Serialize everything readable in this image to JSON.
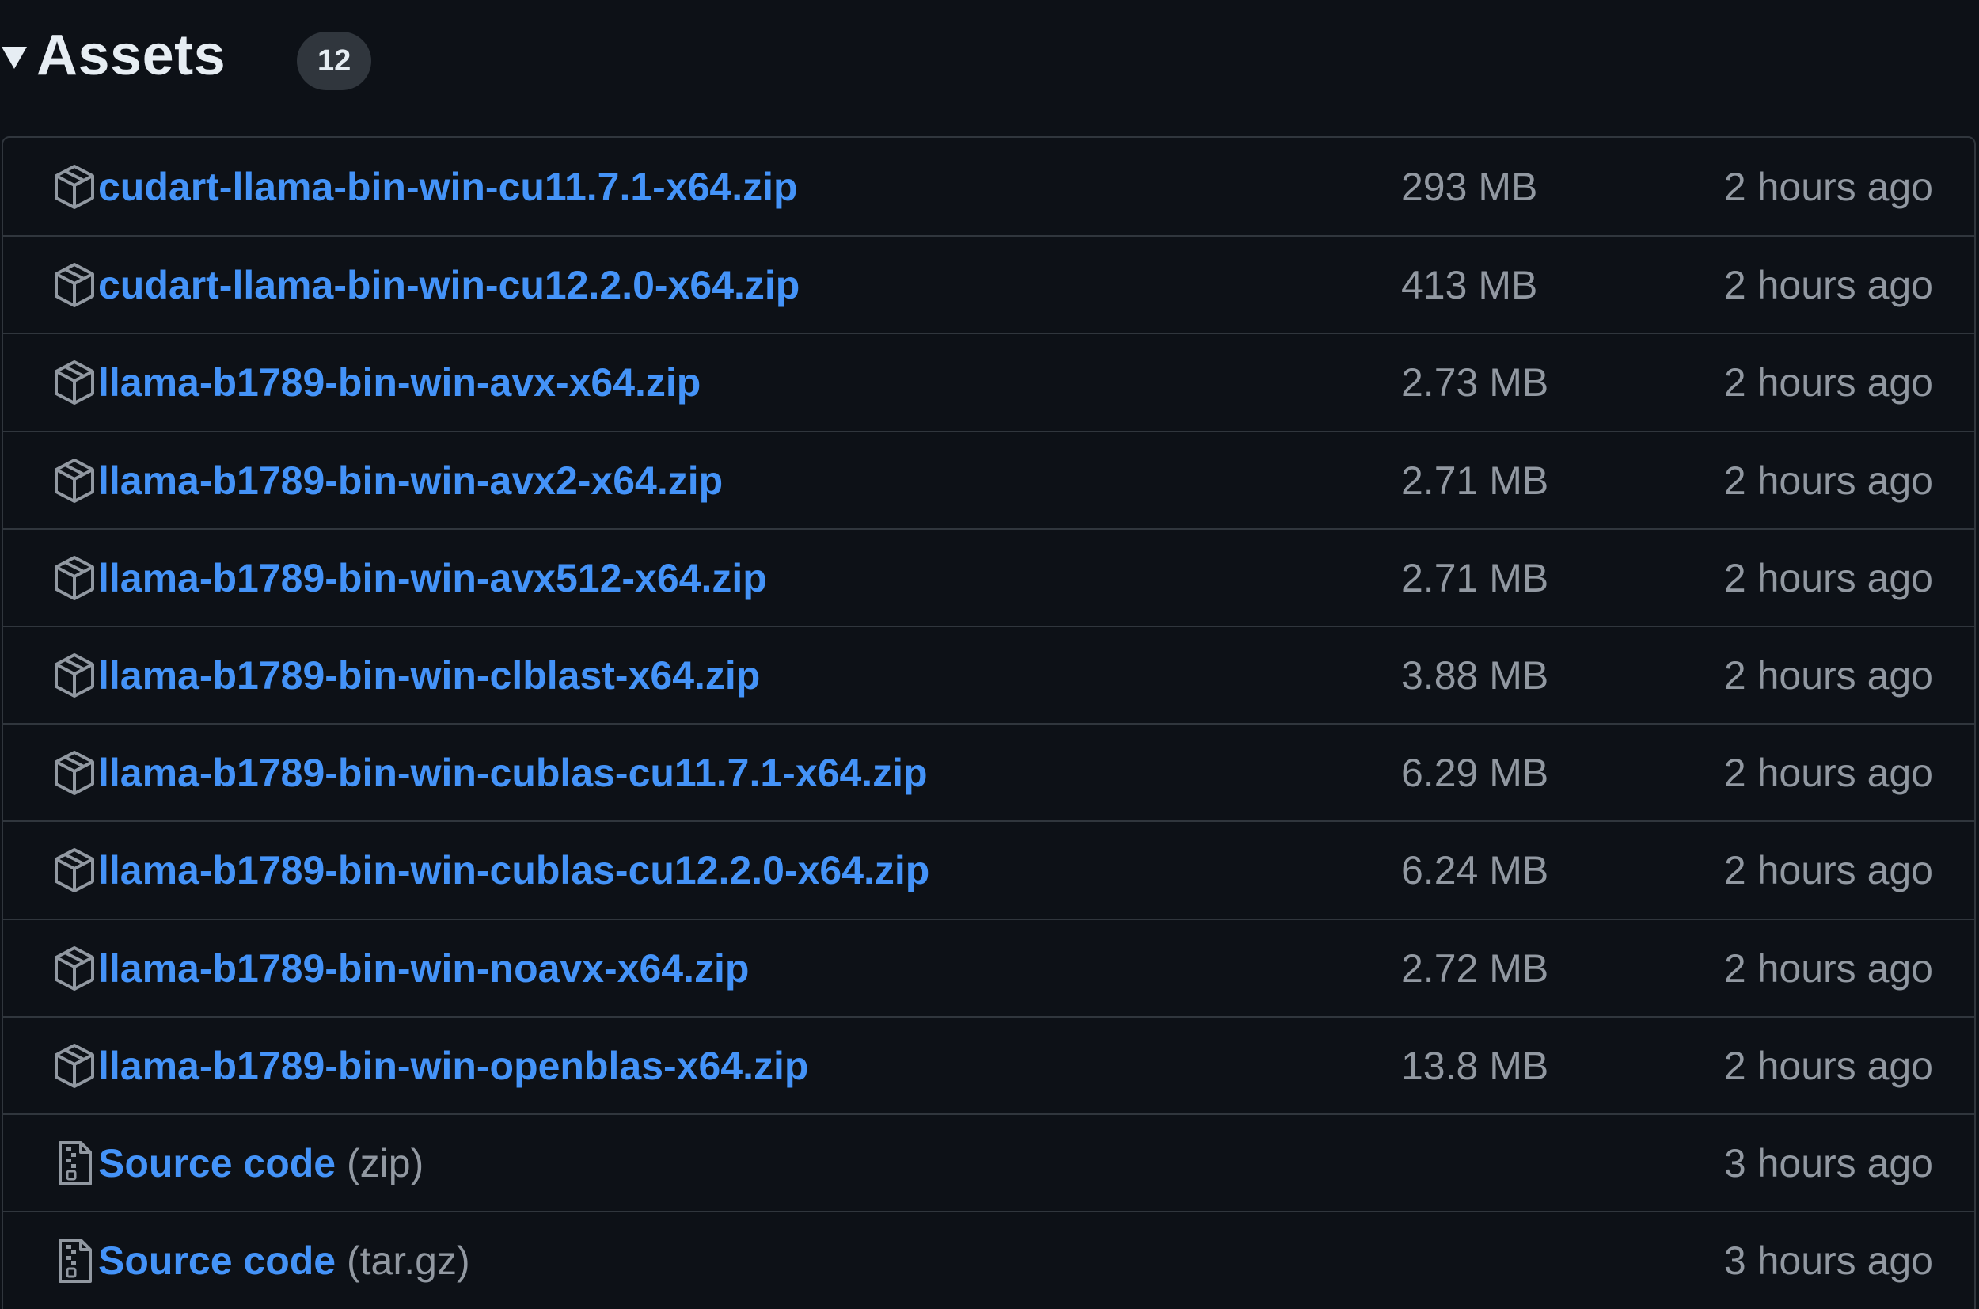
{
  "header": {
    "title": "Assets",
    "count": "12"
  },
  "assets": [
    {
      "name": "cudart-llama-bin-win-cu11.7.1-x64.zip",
      "size": "293 MB",
      "time": "2 hours ago",
      "icon": "package-icon"
    },
    {
      "name": "cudart-llama-bin-win-cu12.2.0-x64.zip",
      "size": "413 MB",
      "time": "2 hours ago",
      "icon": "package-icon"
    },
    {
      "name": "llama-b1789-bin-win-avx-x64.zip",
      "size": "2.73 MB",
      "time": "2 hours ago",
      "icon": "package-icon"
    },
    {
      "name": "llama-b1789-bin-win-avx2-x64.zip",
      "size": "2.71 MB",
      "time": "2 hours ago",
      "icon": "package-icon"
    },
    {
      "name": "llama-b1789-bin-win-avx512-x64.zip",
      "size": "2.71 MB",
      "time": "2 hours ago",
      "icon": "package-icon"
    },
    {
      "name": "llama-b1789-bin-win-clblast-x64.zip",
      "size": "3.88 MB",
      "time": "2 hours ago",
      "icon": "package-icon"
    },
    {
      "name": "llama-b1789-bin-win-cublas-cu11.7.1-x64.zip",
      "size": "6.29 MB",
      "time": "2 hours ago",
      "icon": "package-icon"
    },
    {
      "name": "llama-b1789-bin-win-cublas-cu12.2.0-x64.zip",
      "size": "6.24 MB",
      "time": "2 hours ago",
      "icon": "package-icon"
    },
    {
      "name": "llama-b1789-bin-win-noavx-x64.zip",
      "size": "2.72 MB",
      "time": "2 hours ago",
      "icon": "package-icon"
    },
    {
      "name": "llama-b1789-bin-win-openblas-x64.zip",
      "size": "13.8 MB",
      "time": "2 hours ago",
      "icon": "package-icon"
    },
    {
      "name": "Source code",
      "suffix": "(zip)",
      "size": "",
      "time": "3 hours ago",
      "icon": "file-zip-icon"
    },
    {
      "name": "Source code",
      "suffix": "(tar.gz)",
      "size": "",
      "time": "3 hours ago",
      "icon": "file-zip-icon"
    }
  ],
  "colors": {
    "background": "#0d1117",
    "link": "#4493f8",
    "muted": "#9198a1",
    "border": "#30363d"
  }
}
